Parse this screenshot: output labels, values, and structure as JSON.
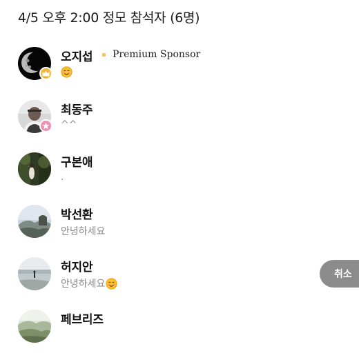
{
  "header": {
    "title": "4/5 오후 2:00 정모 참석자 (6명)"
  },
  "members": [
    {
      "name": "오지섭",
      "status": "",
      "status_emoji": "smiling-face-emoji",
      "badge": "crown-badge-icon",
      "sponsor": "Premium Sponsor"
    },
    {
      "name": "최동주",
      "status": "^^",
      "badge": "star-badge-icon"
    },
    {
      "name": "구본애",
      "status": "."
    },
    {
      "name": "박선환",
      "status": "안녕하세요"
    },
    {
      "name": "허지안",
      "status": "안녕하세요",
      "status_emoji": "smiling-face-emoji"
    },
    {
      "name": "페브리즈",
      "status": ""
    }
  ],
  "cancel_button": {
    "label": "취소"
  },
  "colors": {
    "sponsor_accent": "#f2c46b",
    "crown_badge": "#f2b43a",
    "star_badge": "#f28cb1",
    "status_text": "#8a8a8a",
    "cancel_button_bg": "#8c8c8c"
  }
}
